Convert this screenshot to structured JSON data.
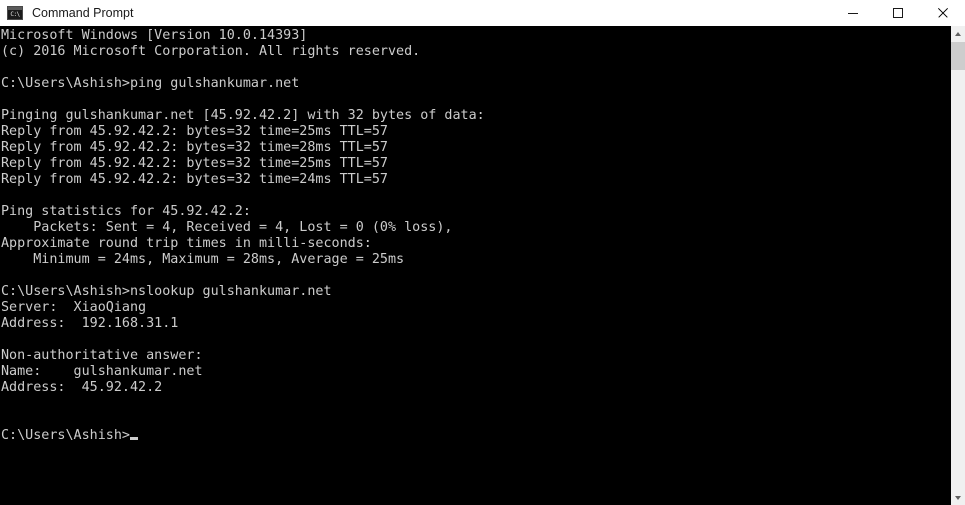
{
  "window": {
    "title": "Command Prompt",
    "icon_name": "console-icon",
    "icon_text": "C:\\",
    "controls": {
      "minimize_label": "Minimize",
      "maximize_label": "Maximize",
      "close_label": "Close"
    },
    "colors": {
      "titlebar_background": "#ffffff",
      "titlebar_text": "#1a1a1a",
      "console_background": "#000000",
      "console_text": "#cccccc",
      "scrollbar_track": "#f0f0f0",
      "scrollbar_thumb": "#cdcdcd"
    }
  },
  "console": {
    "lines": [
      "Microsoft Windows [Version 10.0.14393]",
      "(c) 2016 Microsoft Corporation. All rights reserved.",
      "",
      "C:\\Users\\Ashish>ping gulshankumar.net",
      "",
      "Pinging gulshankumar.net [45.92.42.2] with 32 bytes of data:",
      "Reply from 45.92.42.2: bytes=32 time=25ms TTL=57",
      "Reply from 45.92.42.2: bytes=32 time=28ms TTL=57",
      "Reply from 45.92.42.2: bytes=32 time=25ms TTL=57",
      "Reply from 45.92.42.2: bytes=32 time=24ms TTL=57",
      "",
      "Ping statistics for 45.92.42.2:",
      "    Packets: Sent = 4, Received = 4, Lost = 0 (0% loss),",
      "Approximate round trip times in milli-seconds:",
      "    Minimum = 24ms, Maximum = 28ms, Average = 25ms",
      "",
      "C:\\Users\\Ashish>nslookup gulshankumar.net",
      "Server:  XiaoQiang",
      "Address:  192.168.31.1",
      "",
      "Non-authoritative answer:",
      "Name:    gulshankumar.net",
      "Address:  45.92.42.2",
      "",
      ""
    ],
    "prompt": "C:\\Users\\Ashish>",
    "session": {
      "os_name": "Microsoft Windows",
      "os_version": "10.0.14393",
      "copyright_year": "2016",
      "copyright_owner": "Microsoft Corporation",
      "user_path": "C:\\Users\\Ashish",
      "commands": [
        "ping gulshankumar.net",
        "nslookup gulshankumar.net"
      ],
      "ping": {
        "host": "gulshankumar.net",
        "resolved_ip": "45.92.42.2",
        "payload_bytes": "32",
        "replies": [
          {
            "from": "45.92.42.2",
            "bytes": "32",
            "time": "25ms",
            "ttl": "57"
          },
          {
            "from": "45.92.42.2",
            "bytes": "32",
            "time": "28ms",
            "ttl": "57"
          },
          {
            "from": "45.92.42.2",
            "bytes": "32",
            "time": "25ms",
            "ttl": "57"
          },
          {
            "from": "45.92.42.2",
            "bytes": "32",
            "time": "24ms",
            "ttl": "57"
          }
        ],
        "statistics": {
          "sent": "4",
          "received": "4",
          "lost": "0",
          "loss_percent": "0%",
          "minimum": "24ms",
          "maximum": "28ms",
          "average": "25ms"
        }
      },
      "nslookup": {
        "server": "XiaoQiang",
        "server_address": "192.168.31.1",
        "answer_type": "Non-authoritative answer:",
        "name": "gulshankumar.net",
        "address": "45.92.42.2"
      }
    }
  },
  "scrollbar": {
    "up_arrow": "scroll-up-arrow",
    "down_arrow": "scroll-down-arrow"
  }
}
